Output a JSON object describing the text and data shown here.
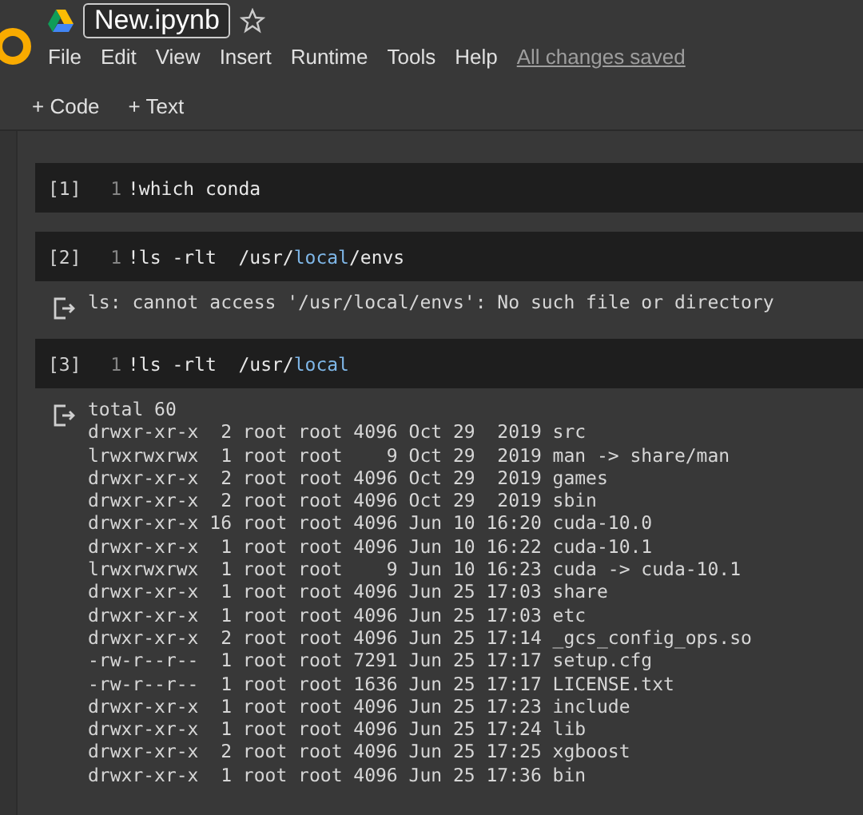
{
  "header": {
    "notebook_name": "New.ipynb",
    "starred": false,
    "menu": [
      "File",
      "Edit",
      "View",
      "Insert",
      "Runtime",
      "Tools",
      "Help"
    ],
    "save_status": "All changes saved"
  },
  "toolbar": {
    "buttons": [
      "+ Code",
      "+ Text"
    ]
  },
  "cells": [
    {
      "prompt": "[1]",
      "line_number": "1",
      "code": [
        {
          "text": "!which conda",
          "kind": "plain"
        }
      ]
    },
    {
      "prompt": "[2]",
      "line_number": "1",
      "code": [
        {
          "text": "!ls -rlt  /usr/",
          "kind": "plain"
        },
        {
          "text": "local",
          "kind": "keyword"
        },
        {
          "text": "/envs",
          "kind": "plain"
        }
      ],
      "output": [
        "ls: cannot access '/usr/local/envs': No such file or directory"
      ]
    },
    {
      "prompt": "[3]",
      "line_number": "1",
      "code": [
        {
          "text": "!ls -rlt  /usr/",
          "kind": "plain"
        },
        {
          "text": "local",
          "kind": "keyword"
        }
      ],
      "output": [
        "total 60",
        "drwxr-xr-x  2 root root 4096 Oct 29  2019 src",
        "lrwxrwxrwx  1 root root    9 Oct 29  2019 man -> share/man",
        "drwxr-xr-x  2 root root 4096 Oct 29  2019 games",
        "drwxr-xr-x  2 root root 4096 Oct 29  2019 sbin",
        "drwxr-xr-x 16 root root 4096 Jun 10 16:20 cuda-10.0",
        "drwxr-xr-x  1 root root 4096 Jun 10 16:22 cuda-10.1",
        "lrwxrwxrwx  1 root root    9 Jun 10 16:23 cuda -> cuda-10.1",
        "drwxr-xr-x  1 root root 4096 Jun 25 17:03 share",
        "drwxr-xr-x  1 root root 4096 Jun 25 17:03 etc",
        "drwxr-xr-x  2 root root 4096 Jun 25 17:14 _gcs_config_ops.so",
        "-rw-r--r--  1 root root 7291 Jun 25 17:17 setup.cfg",
        "-rw-r--r--  1 root root 1636 Jun 25 17:17 LICENSE.txt",
        "drwxr-xr-x  1 root root 4096 Jun 25 17:23 include",
        "drwxr-xr-x  1 root root 4096 Jun 25 17:24 lib",
        "drwxr-xr-x  2 root root 4096 Jun 25 17:25 xgboost",
        "drwxr-xr-x  1 root root 4096 Jun 25 17:36 bin"
      ]
    }
  ]
}
